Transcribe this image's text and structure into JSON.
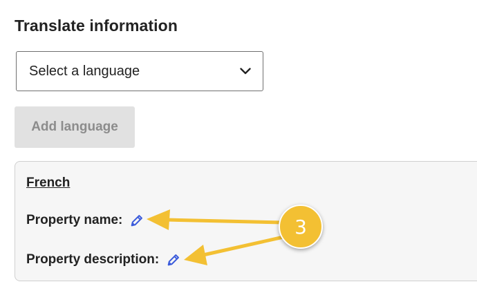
{
  "header": {
    "title": "Translate information"
  },
  "language_select": {
    "value": "Select a language",
    "icon": "chevron-down-icon"
  },
  "add_button": {
    "label": "Add language",
    "disabled": true
  },
  "language_card": {
    "language": "French",
    "fields": [
      {
        "label": "Property name:",
        "icon": "pencil-icon"
      },
      {
        "label": "Property description:",
        "icon": "pencil-icon"
      }
    ]
  },
  "annotation": {
    "step_number": "3",
    "color": "#f3c033"
  },
  "colors": {
    "edit_icon": "#3b5bdb",
    "disabled_button_bg": "#e1e1e1",
    "disabled_button_text": "#8c8c8c",
    "card_bg": "#f6f6f6"
  }
}
